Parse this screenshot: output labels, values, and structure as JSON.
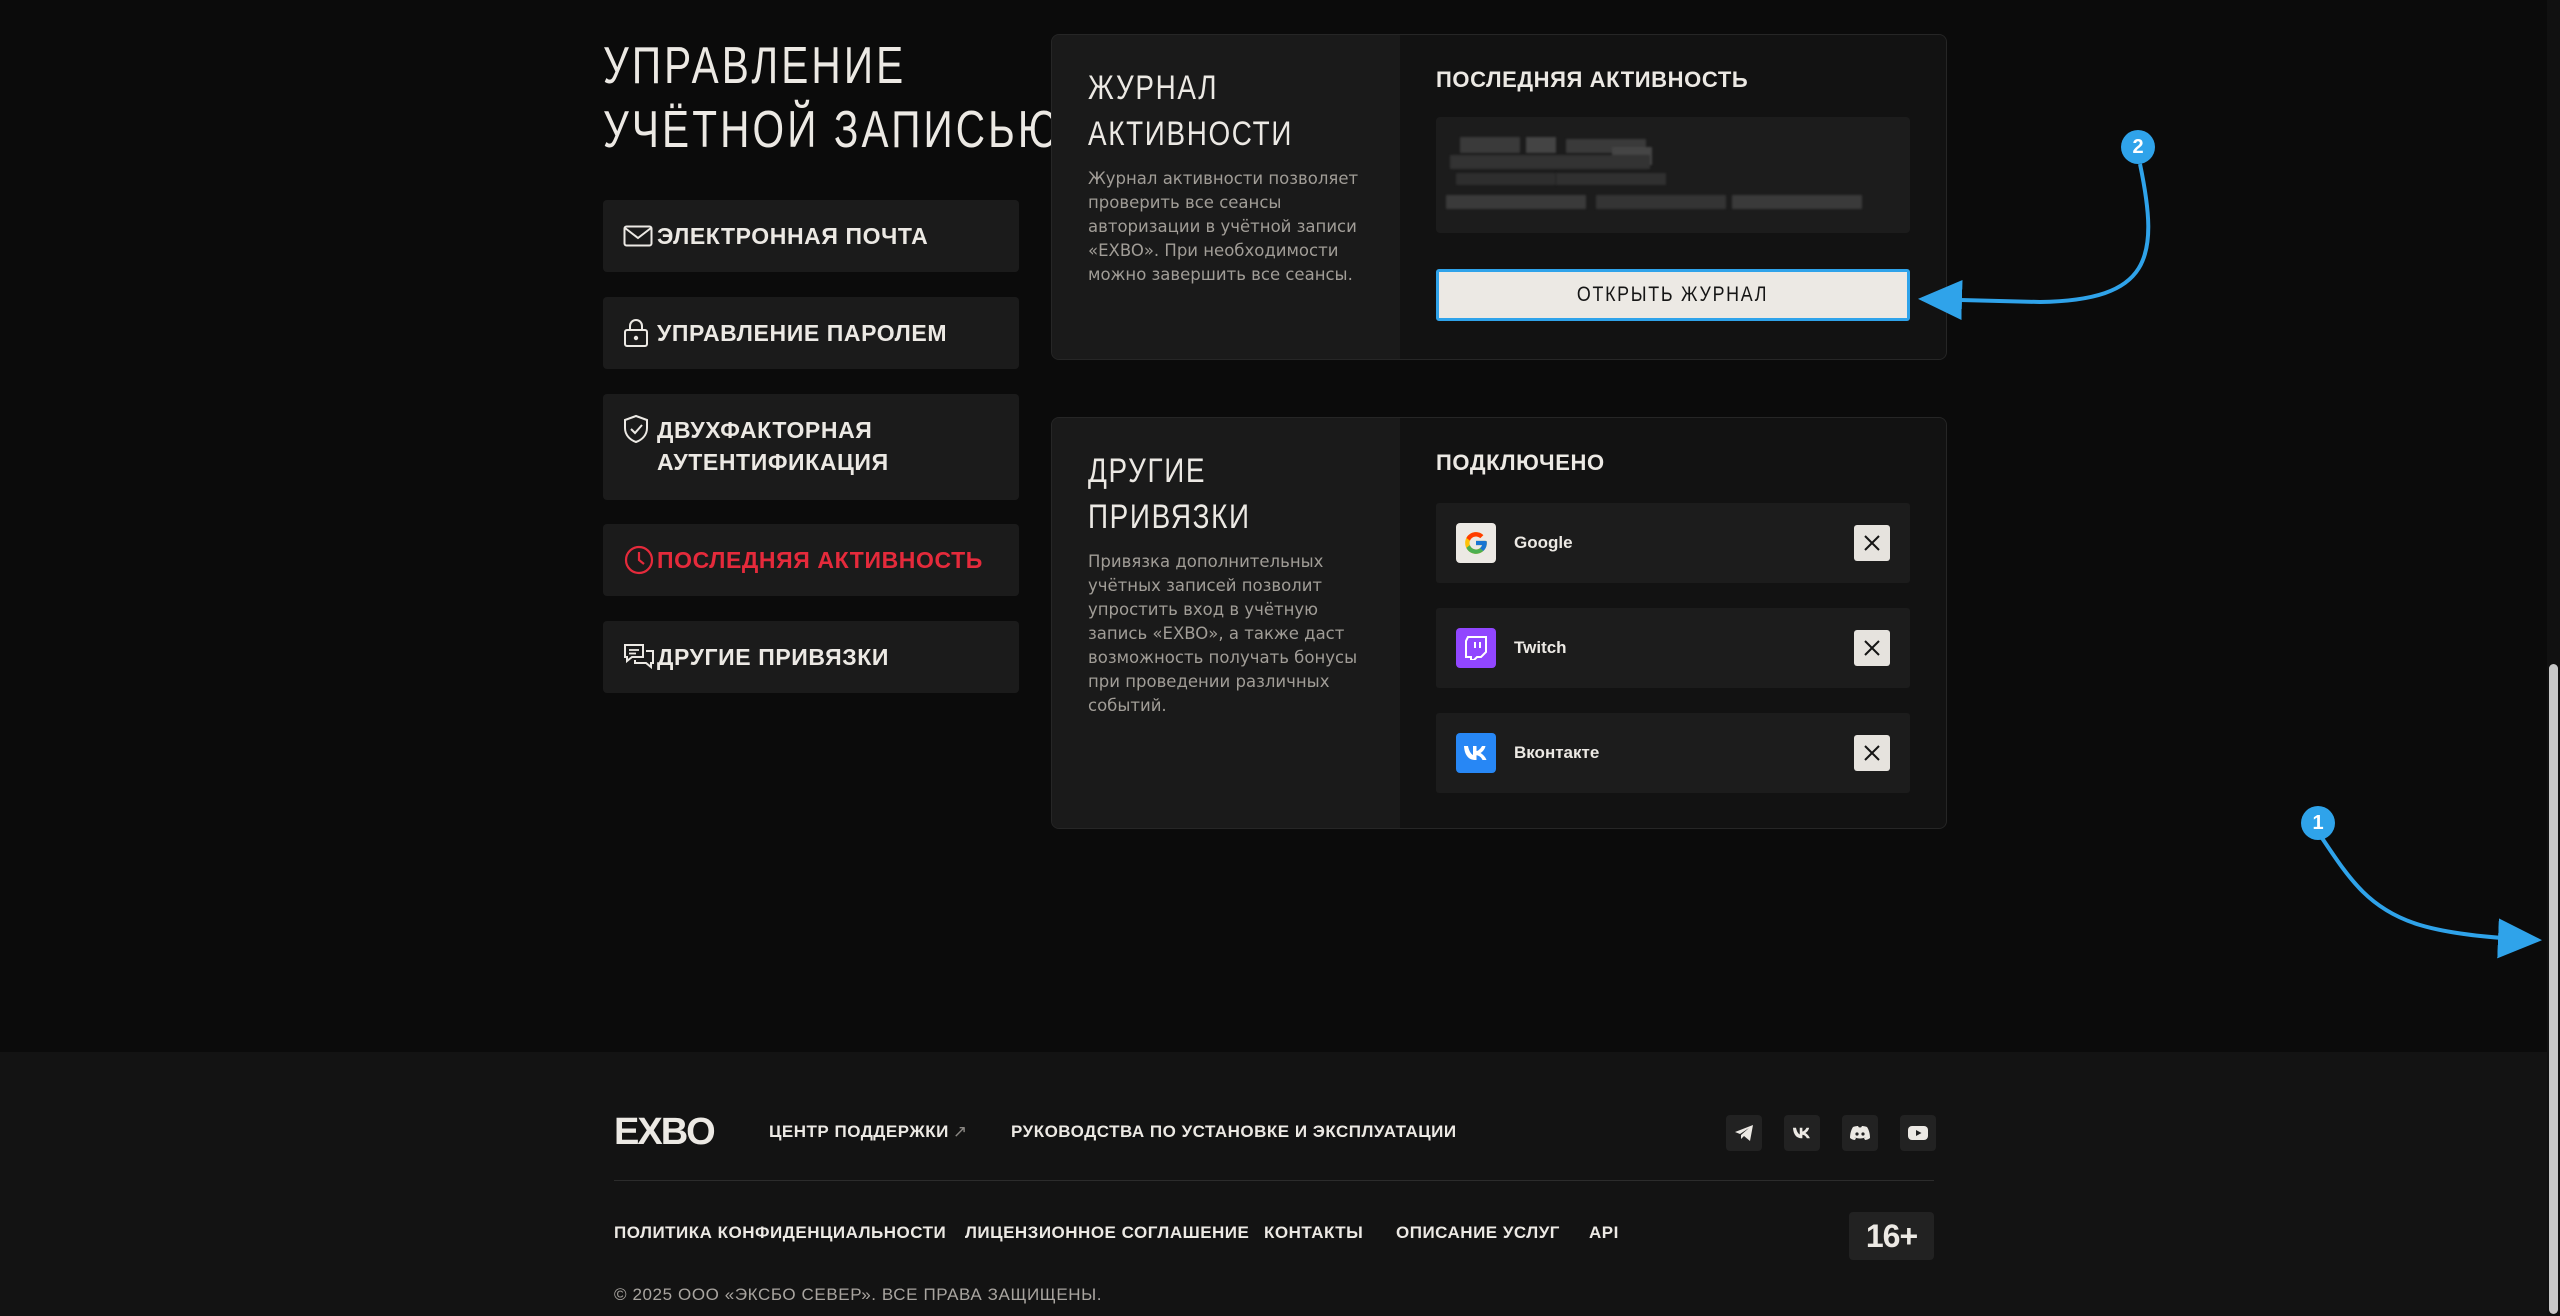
{
  "page": {
    "title_line1": "УПРАВЛЕНИЕ",
    "title_line2": "УЧЁТНОЙ ЗАПИСЬЮ"
  },
  "sidebar": {
    "items": [
      {
        "label": "ЭЛЕКТРОННАЯ ПОЧТА",
        "icon": "mail-icon"
      },
      {
        "label": "УПРАВЛЕНИЕ ПАРОЛЕМ",
        "icon": "lock-icon"
      },
      {
        "label_line1": "ДВУХФАКТОРНАЯ",
        "label_line2": "АУТЕНТИФИКАЦИЯ",
        "icon": "shield-check-icon"
      },
      {
        "label": "ПОСЛЕДНЯЯ АКТИВНОСТЬ",
        "icon": "clock-icon",
        "active": true
      },
      {
        "label": "ДРУГИЕ ПРИВЯЗКИ",
        "icon": "chat-bubbles-icon"
      }
    ]
  },
  "activity_card": {
    "title_line1": "ЖУРНАЛ",
    "title_line2": "АКТИВНОСТИ",
    "description": "Журнал активности позволяет проверить все сеансы авторизации в учётной записи «EXBO». При необходимости можно завершить все сеансы.",
    "right_heading": "ПОСЛЕДНЯЯ АКТИВНОСТЬ",
    "button_label": "ОТКРЫТЬ ЖУРНАЛ"
  },
  "links_card": {
    "title": "ДРУГИЕ ПРИВЯЗКИ",
    "description": "Привязка дополнительных учётных записей позволит упростить вход в учётную запись «EXBO», а также даст возможность получать бонусы при проведении различных событий.",
    "right_heading": "ПОДКЛЮЧЕНО",
    "providers": [
      {
        "name": "Google",
        "icon": "google-icon"
      },
      {
        "name": "Twitch",
        "icon": "twitch-icon",
        "color": "#9146ff"
      },
      {
        "name": "Вконтакте",
        "icon": "vk-icon",
        "color": "#2787f5"
      }
    ]
  },
  "annotations": {
    "badge1": "1",
    "badge2": "2",
    "color": "#2fa3ea"
  },
  "footer": {
    "logo_text": "EXBO",
    "support_link": "ЦЕНТР ПОДДЕРЖКИ",
    "guides_link": "РУКОВОДСТВА ПО УСТАНОВКЕ И ЭКСПЛУАТАЦИИ",
    "privacy": "ПОЛИТИКА КОНФИДЕНЦИАЛЬНОСТИ",
    "license": "ЛИЦЕНЗИОННОЕ СОГЛАШЕНИЕ",
    "contacts": "КОНТАКТЫ",
    "services": "ОПИСАНИЕ УСЛУГ",
    "api": "API",
    "age_rating": "16+",
    "copyright": "© 2025 ООО «ЭКСБО СЕВЕР». ВСЕ ПРАВА ЗАЩИЩЕНЫ.",
    "socials": [
      "telegram-icon",
      "vk-icon",
      "discord-icon",
      "youtube-icon"
    ]
  },
  "colors": {
    "background": "#0b0b0b",
    "accent_active": "#e52a3b",
    "annotation": "#2fa3ea"
  }
}
